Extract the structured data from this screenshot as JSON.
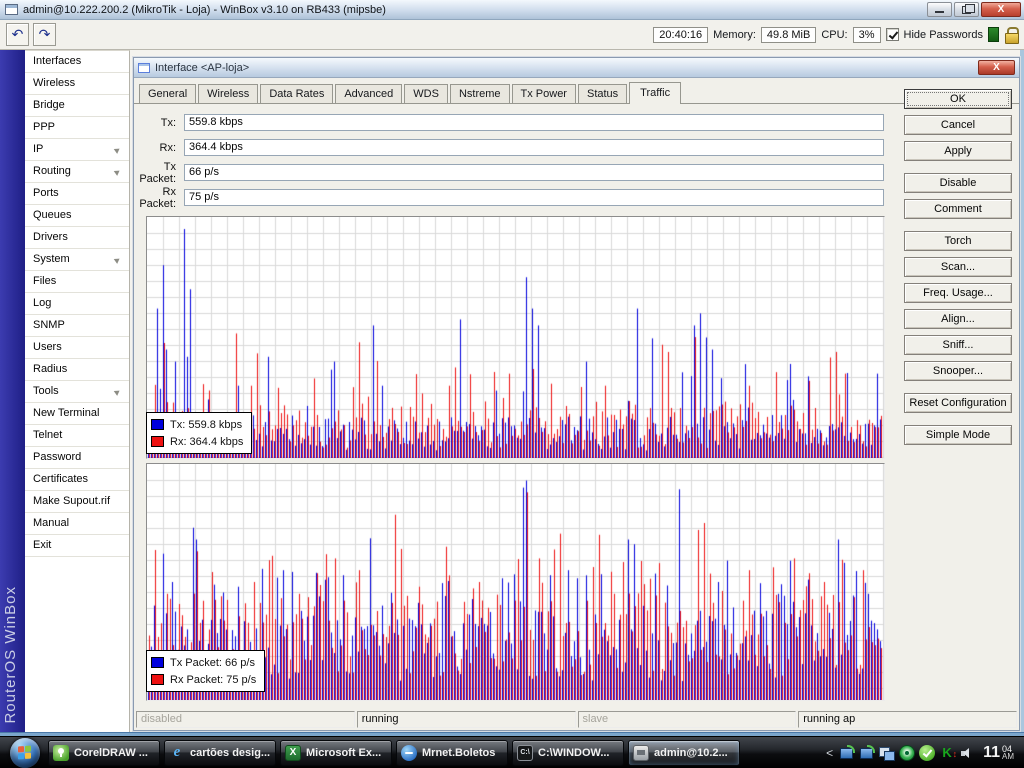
{
  "app": {
    "title": "admin@10.222.200.2 (MikroTik - Loja) - WinBox v3.10 on RB433 (mipsbe)"
  },
  "toolbar": {
    "time": "20:40:16",
    "memory_label": "Memory:",
    "memory_value": "49.8 MiB",
    "cpu_label": "CPU:",
    "cpu_value": "3%",
    "hide_passwords_label": "Hide Passwords",
    "hide_passwords_checked": true
  },
  "brand": {
    "vertical_text": "RouterOS WinBox"
  },
  "sidebar": {
    "items": [
      {
        "label": "Interfaces",
        "submenu": false
      },
      {
        "label": "Wireless",
        "submenu": false
      },
      {
        "label": "Bridge",
        "submenu": false
      },
      {
        "label": "PPP",
        "submenu": false
      },
      {
        "label": "IP",
        "submenu": true
      },
      {
        "label": "Routing",
        "submenu": true
      },
      {
        "label": "Ports",
        "submenu": false
      },
      {
        "label": "Queues",
        "submenu": false
      },
      {
        "label": "Drivers",
        "submenu": false
      },
      {
        "label": "System",
        "submenu": true
      },
      {
        "label": "Files",
        "submenu": false
      },
      {
        "label": "Log",
        "submenu": false
      },
      {
        "label": "SNMP",
        "submenu": false
      },
      {
        "label": "Users",
        "submenu": false
      },
      {
        "label": "Radius",
        "submenu": false
      },
      {
        "label": "Tools",
        "submenu": true
      },
      {
        "label": "New Terminal",
        "submenu": false
      },
      {
        "label": "Telnet",
        "submenu": false
      },
      {
        "label": "Password",
        "submenu": false
      },
      {
        "label": "Certificates",
        "submenu": false
      },
      {
        "label": "Make Supout.rif",
        "submenu": false
      },
      {
        "label": "Manual",
        "submenu": false
      },
      {
        "label": "Exit",
        "submenu": false
      }
    ]
  },
  "dialog": {
    "title": "Interface <AP-loja>",
    "tabs": [
      "General",
      "Wireless",
      "Data Rates",
      "Advanced",
      "WDS",
      "Nstreme",
      "Tx Power",
      "Status",
      "Traffic"
    ],
    "active_tab": "Traffic",
    "fields": [
      {
        "label": "Tx:",
        "value": "559.8 kbps"
      },
      {
        "label": "Rx:",
        "value": "364.4 kbps"
      },
      {
        "label": "Tx Packet:",
        "value": "66 p/s"
      },
      {
        "label": "Rx Packet:",
        "value": "75 p/s"
      }
    ],
    "buttons": [
      {
        "label": "OK",
        "group": 0,
        "default": true
      },
      {
        "label": "Cancel",
        "group": 0
      },
      {
        "label": "Apply",
        "group": 0
      },
      {
        "label": "Disable",
        "group": 1
      },
      {
        "label": "Comment",
        "group": 1
      },
      {
        "label": "Torch",
        "group": 2
      },
      {
        "label": "Scan...",
        "group": 2
      },
      {
        "label": "Freq. Usage...",
        "group": 2
      },
      {
        "label": "Align...",
        "group": 2
      },
      {
        "label": "Sniff...",
        "group": 2
      },
      {
        "label": "Snooper...",
        "group": 2
      },
      {
        "label": "Reset Configuration",
        "group": 3
      },
      {
        "label": "Simple Mode",
        "group": 4
      }
    ],
    "status": [
      {
        "text": "disabled",
        "dim": true
      },
      {
        "text": "running",
        "dim": false
      },
      {
        "text": "slave",
        "dim": true
      },
      {
        "text": "running ap",
        "dim": false
      }
    ]
  },
  "charts": [
    {
      "name": "traffic-bitrate",
      "legend": [
        {
          "color": "#0000dd",
          "text": "Tx:  559.8 kbps"
        },
        {
          "color": "#ee1111",
          "text": "Rx:  364.4 kbps"
        }
      ],
      "gen": {
        "seed": 101,
        "samples": 245,
        "tx_color": "#0000dd",
        "rx_color": "#ee1111",
        "tx_base": [
          0.03,
          0.15
        ],
        "tx_mid_chance": 0.06,
        "tx_mid": [
          0.2,
          0.2
        ],
        "tx_spike_chance": 0.012,
        "tx_spike": [
          0.45,
          0.5
        ],
        "rx_base": [
          0.04,
          0.2
        ],
        "rx_mid_chance": 0.1,
        "rx_mid": [
          0.22,
          0.2
        ],
        "rx_spike_chance": 0.01,
        "rx_spike": [
          0.4,
          0.12
        ],
        "tx_extra": [
          [
            3,
            0.62
          ],
          [
            5,
            0.8
          ],
          [
            6,
            0.45
          ],
          [
            9,
            0.4
          ],
          [
            12,
            0.95
          ],
          [
            13,
            0.42
          ],
          [
            14,
            0.7
          ],
          [
            30,
            0.3
          ],
          [
            40,
            0.42
          ],
          [
            62,
            0.4
          ],
          [
            75,
            0.55
          ],
          [
            78,
            0.3
          ],
          [
            126,
            0.75
          ],
          [
            128,
            0.62
          ],
          [
            130,
            0.55
          ],
          [
            146,
            0.4
          ],
          [
            163,
            0.62
          ],
          [
            182,
            0.55
          ],
          [
            184,
            0.6
          ],
          [
            186,
            0.5
          ],
          [
            188,
            0.45
          ],
          [
            243,
            0.35
          ]
        ],
        "rx_extra": [
          [
            20,
            0.28
          ],
          [
            34,
            0.3
          ],
          [
            55,
            0.33
          ],
          [
            70,
            0.48
          ],
          [
            100,
            0.3
          ],
          [
            120,
            0.35
          ],
          [
            152,
            0.3
          ],
          [
            171,
            0.47
          ],
          [
            173,
            0.44
          ],
          [
            200,
            0.3
          ],
          [
            220,
            0.32
          ],
          [
            232,
            0.35
          ]
        ]
      }
    },
    {
      "name": "traffic-packets",
      "legend": [
        {
          "color": "#0000dd",
          "text": "Tx Packet:  66 p/s"
        },
        {
          "color": "#ee1111",
          "text": "Rx Packet:  75 p/s"
        }
      ],
      "gen": {
        "seed": 202,
        "samples": 245,
        "tx_color": "#0000dd",
        "rx_color": "#ee1111",
        "tx_base": [
          0.08,
          0.3
        ],
        "tx_mid_chance": 0.15,
        "tx_mid": [
          0.35,
          0.25
        ],
        "tx_spike_chance": 0.01,
        "tx_spike": [
          0.6,
          0.3
        ],
        "rx_base": [
          0.1,
          0.35
        ],
        "rx_mid_chance": 0.15,
        "rx_mid": [
          0.4,
          0.25
        ],
        "rx_spike_chance": 0.012,
        "rx_spike": [
          0.55,
          0.3
        ],
        "tx_extra": [
          [
            2,
            0.4
          ],
          [
            5,
            0.62
          ],
          [
            8,
            0.5
          ],
          [
            15,
            0.73
          ],
          [
            16,
            0.68
          ],
          [
            30,
            0.48
          ],
          [
            45,
            0.55
          ],
          [
            60,
            0.52
          ],
          [
            78,
            0.4
          ],
          [
            125,
            0.9
          ],
          [
            126,
            0.93
          ],
          [
            140,
            0.55
          ],
          [
            160,
            0.68
          ],
          [
            162,
            0.66
          ],
          [
            190,
            0.5
          ],
          [
            210,
            0.45
          ],
          [
            230,
            0.68
          ],
          [
            240,
            0.45
          ]
        ],
        "rx_extra": [
          [
            6,
            0.45
          ],
          [
            16,
            0.63
          ],
          [
            35,
            0.5
          ],
          [
            50,
            0.45
          ],
          [
            70,
            0.55
          ],
          [
            90,
            0.48
          ],
          [
            110,
            0.5
          ],
          [
            126,
            0.88
          ],
          [
            130,
            0.6
          ],
          [
            150,
            0.7
          ],
          [
            155,
            0.45
          ],
          [
            170,
            0.58
          ],
          [
            185,
            0.75
          ],
          [
            200,
            0.55
          ],
          [
            215,
            0.6
          ],
          [
            225,
            0.5
          ],
          [
            238,
            0.55
          ]
        ]
      }
    }
  ],
  "taskbar": {
    "buttons": [
      {
        "label": "CorelDRAW ...",
        "icon": "coreldraw-icon",
        "active": false
      },
      {
        "label": "cartões desig...",
        "icon": "internet-explorer-icon",
        "active": false
      },
      {
        "label": "Microsoft Ex...",
        "icon": "excel-icon",
        "active": false
      },
      {
        "label": "Mrnet.Boletos",
        "icon": "mrnet-icon",
        "active": false
      },
      {
        "label": "C:\\WINDOW...",
        "icon": "command-prompt-icon",
        "active": false
      },
      {
        "label": "admin@10.2...",
        "icon": "winbox-icon",
        "active": true
      }
    ],
    "clock": {
      "hour": "11",
      "minute": "04",
      "ampm": "AM"
    }
  }
}
